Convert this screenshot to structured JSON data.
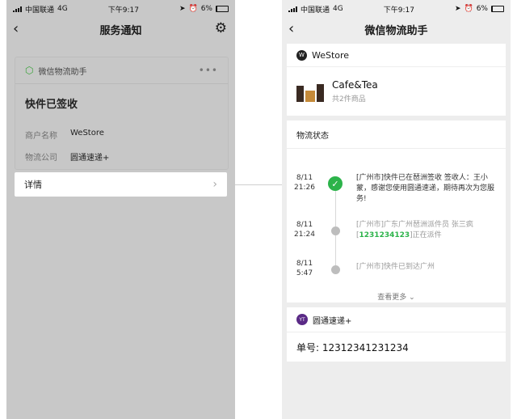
{
  "status_bar": {
    "carrier": "中国联通",
    "network": "4G",
    "time": "下午9:17",
    "battery": "6%"
  },
  "left": {
    "title": "服务通知",
    "card": {
      "source": "微信物流助手",
      "more": "•••",
      "heading": "快件已签收",
      "merchant_label": "商户名称",
      "merchant_value": "WeStore",
      "courier_label": "物流公司",
      "courier_value": "圆通速递+"
    },
    "detail_label": "详情"
  },
  "right": {
    "title": "微信物流助手",
    "store": "WeStore",
    "product_name": "Cafe&Tea",
    "product_count": "共2件商品",
    "logistics_header": "物流状态",
    "events": [
      {
        "date": "8/11",
        "time": "21:26",
        "text": "[广州市]快件已在琶洲签收  签收人：王小蒙，感谢您使用圆通速递，期待再次为您服务!"
      },
      {
        "date": "8/11",
        "time": "21:24",
        "text_pre": "[广州市]广东广州琶洲派件员 张三疯[",
        "tracking": "1231234123",
        "text_post": "]正在派件"
      },
      {
        "date": "8/11",
        "time": "5:47",
        "text": "[广州市]快件已到达广州"
      }
    ],
    "see_more": "查看更多",
    "carrier_name": "圆通速递+",
    "waybill": "单号: 12312341231234"
  },
  "colors": {
    "accent_green": "#2cb34a",
    "overlay_gray": "#c8c8c8"
  }
}
